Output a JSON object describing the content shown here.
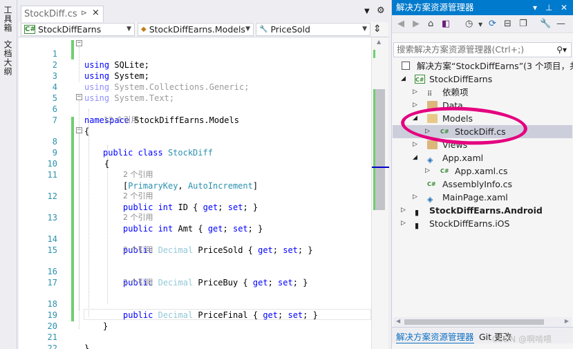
{
  "left_strip": {
    "toolbox": "工具箱",
    "outline": "文档大纲"
  },
  "tab": {
    "title": "StockDiff.cs",
    "pin": "⊳",
    "close": "×"
  },
  "navbar": {
    "project": "StockDiffEarns",
    "class": "StockDiffEarns.Models",
    "member": "PriceSold"
  },
  "code": {
    "line_numbers": [
      "1",
      "2",
      "3",
      "4",
      "5",
      "6",
      "7",
      "8",
      "9",
      "10",
      "11",
      "12",
      "13",
      "14",
      "15",
      "16",
      "17",
      "18",
      "19",
      "20",
      "21",
      "22"
    ],
    "l1_kw": "using",
    "l1_rest": " SQLite;",
    "l2_kw": "using",
    "l2_rest": " System;",
    "l3_kw": "using",
    "l3_rest": " System.Collections.Generic;",
    "l4_kw": "using",
    "l4_rest": " System.Text;",
    "l6_kw": "namespace",
    "l6_rest": " StockDiffEarns.Models",
    "l7": "{",
    "lens_class": "12 个引用",
    "l8_kw": "public class",
    "l8_ty": "StockDiff",
    "l9": "{",
    "l11_open": "[",
    "l11_a": "PrimaryKey",
    "l11_sep": ", ",
    "l11_b": "AutoIncrement",
    "l11_close": "]",
    "lens_ref": "2 个引用",
    "l12_kw": "public int",
    "l12_rest": " ID { ",
    "l12_get": "get",
    "l12_mid": "; ",
    "l12_set": "set",
    "l12_end": "; }",
    "l13_kw": "public int",
    "l13_rest": " Amt { ",
    "l13_get": "get",
    "l13_mid": "; ",
    "l13_set": "set",
    "l13_end": "; }",
    "l14_kw": "public",
    "l14_ty": "Decimal",
    "l14_rest": " PriceSold { ",
    "l14_get": "get",
    "l14_mid": "; ",
    "l14_set": "set",
    "l14_end": "; }",
    "l16_kw": "public",
    "l16_ty": "Decimal",
    "l16_rest": " PriceBuy { ",
    "l16_get": "get",
    "l16_mid": "; ",
    "l16_set": "set",
    "l16_end": "; }",
    "l18_kw": "public",
    "l18_ty": "Decimal",
    "l18_rest": " PriceFinal { ",
    "l18_get": "get",
    "l18_mid": "; ",
    "l18_set": "set",
    "l18_end": "; }",
    "l19": "}",
    "l21": "}"
  },
  "solution": {
    "title": "解决方案资源管理器",
    "search_placeholder": "搜索解决方案资源管理器(Ctrl+;)",
    "items": [
      {
        "label": "解决方案“StockDiffEarns”(3 个项目，共"
      },
      {
        "label": "StockDiffEarns"
      },
      {
        "label": "依赖项"
      },
      {
        "label": "Data"
      },
      {
        "label": "Models"
      },
      {
        "label": "StockDiff.cs"
      },
      {
        "label": "Views"
      },
      {
        "label": "App.xaml"
      },
      {
        "label": "App.xaml.cs"
      },
      {
        "label": "AssemblyInfo.cs"
      },
      {
        "label": "MainPage.xaml"
      },
      {
        "label": "StockDiffEarns.Android"
      },
      {
        "label": "StockDiffEarns.iOS"
      }
    ],
    "bottom_tab_active": "解决方案资源管理器",
    "bottom_tab_git": "Git 更改"
  },
  "watermark": "CSDN @啊啃喂",
  "colors": {
    "accent": "#007acc",
    "highlight_annotation": "#e4007f",
    "change_bar": "#6fcf6f"
  }
}
